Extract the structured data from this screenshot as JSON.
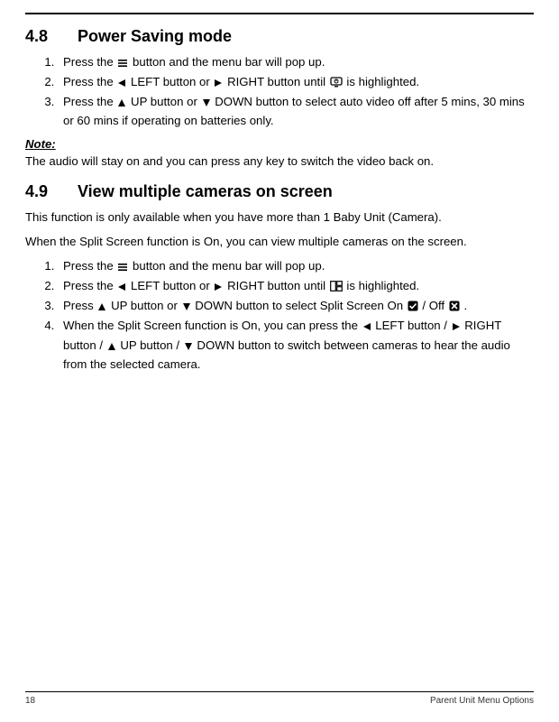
{
  "section48": {
    "number": "4.8",
    "title": "Power Saving mode",
    "steps": {
      "s1a": "Press the ",
      "s1b": " button and the menu bar will pop up.",
      "s2a": "Press the ",
      "s2b": " LEFT button or ",
      "s2c": " RIGHT button until ",
      "s2d": " is highlighted.",
      "s3a": "Press the ",
      "s3b": " UP button or ",
      "s3c": " DOWN button to select auto video off after 5 mins, 30 mins or 60 mins if operating on batteries only."
    },
    "note_label": "Note:",
    "note_body": "The audio will stay on and you can press any key to switch the video back on."
  },
  "section49": {
    "number": "4.9",
    "title": "View multiple cameras on screen",
    "intro1": "This function is only available when you have more than 1 Baby Unit (Camera).",
    "intro2": "When the Split Screen function is On, you can view multiple cameras on the screen.",
    "steps": {
      "s1a": "Press the ",
      "s1b": " button and the menu bar will pop up.",
      "s2a": "Press the ",
      "s2b": " LEFT button or ",
      "s2c": " RIGHT button until ",
      "s2d": " is highlighted.",
      "s3a": "Press",
      "s3b": " UP button or ",
      "s3c": " DOWN button to select Split Screen On ",
      "s3d": " / Off ",
      "s3e": ".",
      "s4a": "When the Split Screen function is On, you can press the ",
      "s4b": " LEFT button / ",
      "s4c": " RIGHT button / ",
      "s4d": " UP button / ",
      "s4e": " DOWN button to switch between cameras to hear the audio from the selected camera."
    }
  },
  "footer": {
    "page_number": "18",
    "chapter": "Parent Unit Menu Options"
  }
}
